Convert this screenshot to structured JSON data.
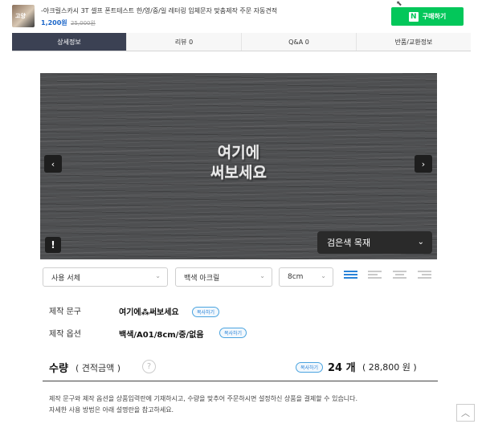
{
  "header": {
    "product_title": "-아크릴스카시 3T 셀프 폰트테스트 한/영/중/일 레터링 입체문자 맞춤제작 주문 자동견적",
    "price": "1,200원",
    "price_original": "25,000원",
    "thumb_text": "고양",
    "buy_logo": "N",
    "buy_label": "구매하기"
  },
  "tabs": [
    {
      "label": "상세정보",
      "active": true
    },
    {
      "label": "리뷰 0",
      "active": false
    },
    {
      "label": "Q&A 0",
      "active": false
    },
    {
      "label": "반품/교환정보",
      "active": false
    }
  ],
  "preview": {
    "line1": "여기에",
    "line2": "써보세요",
    "material": "검은색 목재",
    "prev_icon": "‹",
    "next_icon": "›",
    "info_icon": "!"
  },
  "options": {
    "font": "사용 서체",
    "material": "백색 아크릴",
    "size": "8cm"
  },
  "info": {
    "text_label": "제작 문구",
    "text_value": "여기에⁂써보세요",
    "option_label": "제작 옵션",
    "option_value": "백색/A01/8cm/중/없음",
    "copy_label": "복사하기"
  },
  "quantity": {
    "label": "수량",
    "sub": "( 견적금액 )",
    "help": "?",
    "copy_label": "복사하기",
    "value": "24 개",
    "total": "( 28,800 원 )"
  },
  "description": {
    "line1": "제작 문구와 제작 옵션을 상품입력란에 기재하시고, 수량을 맞추어 주문하시면 설정하신 상품을 결제할 수 있습니다.",
    "line2": "자세한 사용 방법은 아래 설명란을 참고하세요."
  },
  "colors": {
    "accent": "#03c75a",
    "active_tab": "#3b4153",
    "link": "#2a83d8"
  }
}
